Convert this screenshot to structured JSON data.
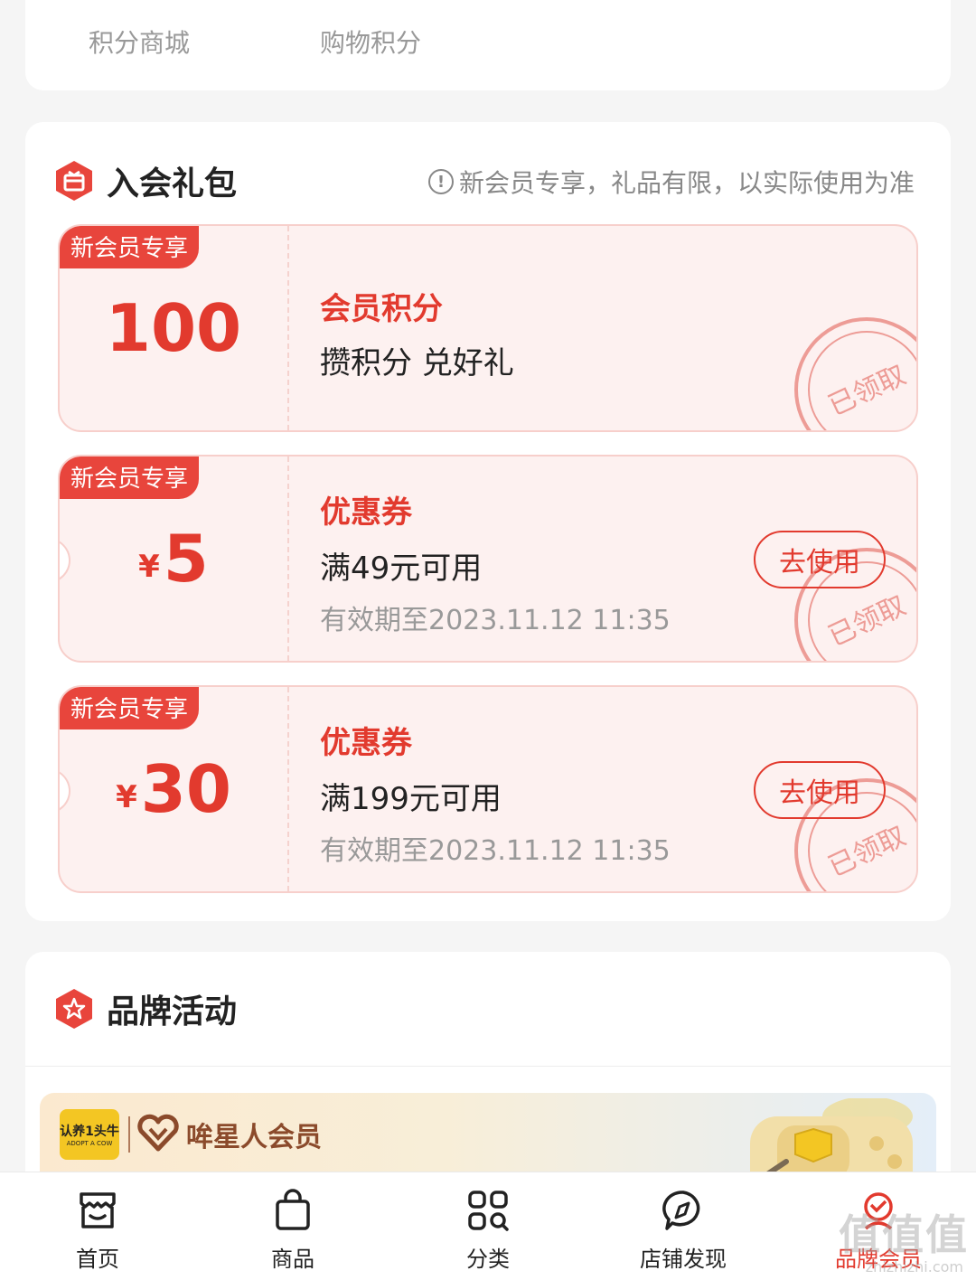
{
  "points_card": {
    "links": [
      "积分商城",
      "购物积分"
    ]
  },
  "gift_section": {
    "title": "入会礼包",
    "note": "新会员专享，礼品有限，以实际使用为准",
    "coupons": [
      {
        "tag": "新会员专享",
        "currency": "",
        "amount": "100",
        "title": "会员积分",
        "desc": "攒积分 兑好礼",
        "date": "",
        "button": "",
        "stamp": "已领取"
      },
      {
        "tag": "新会员专享",
        "currency": "¥",
        "amount": "5",
        "title": "优惠券",
        "desc": "满49元可用",
        "date": "有效期至2023.11.12 11:35",
        "button": "去使用",
        "stamp": "已领取"
      },
      {
        "tag": "新会员专享",
        "currency": "¥",
        "amount": "30",
        "title": "优惠券",
        "desc": "满199元可用",
        "date": "有效期至2023.11.12 11:35",
        "button": "去使用",
        "stamp": "已领取"
      }
    ]
  },
  "brand_section": {
    "title": "品牌活动",
    "banner": {
      "logo_line1": "认养1头牛",
      "logo_line2": "ADOPT A COW",
      "name": "哞星人会员"
    }
  },
  "tabbar": {
    "items": [
      {
        "label": "首页",
        "icon": "home-shop-icon"
      },
      {
        "label": "商品",
        "icon": "bag-icon"
      },
      {
        "label": "分类",
        "icon": "grid-icon"
      },
      {
        "label": "店铺发现",
        "icon": "discover-icon"
      },
      {
        "label": "品牌会员",
        "icon": "member-icon"
      }
    ],
    "active_index": 4
  },
  "watermark": {
    "text": "值值值",
    "sub": "zhizhizhi.com"
  },
  "colors": {
    "accent": "#e23a2e",
    "coupon_bg": "#fdf1f0",
    "tag_bg": "#e8453c"
  }
}
